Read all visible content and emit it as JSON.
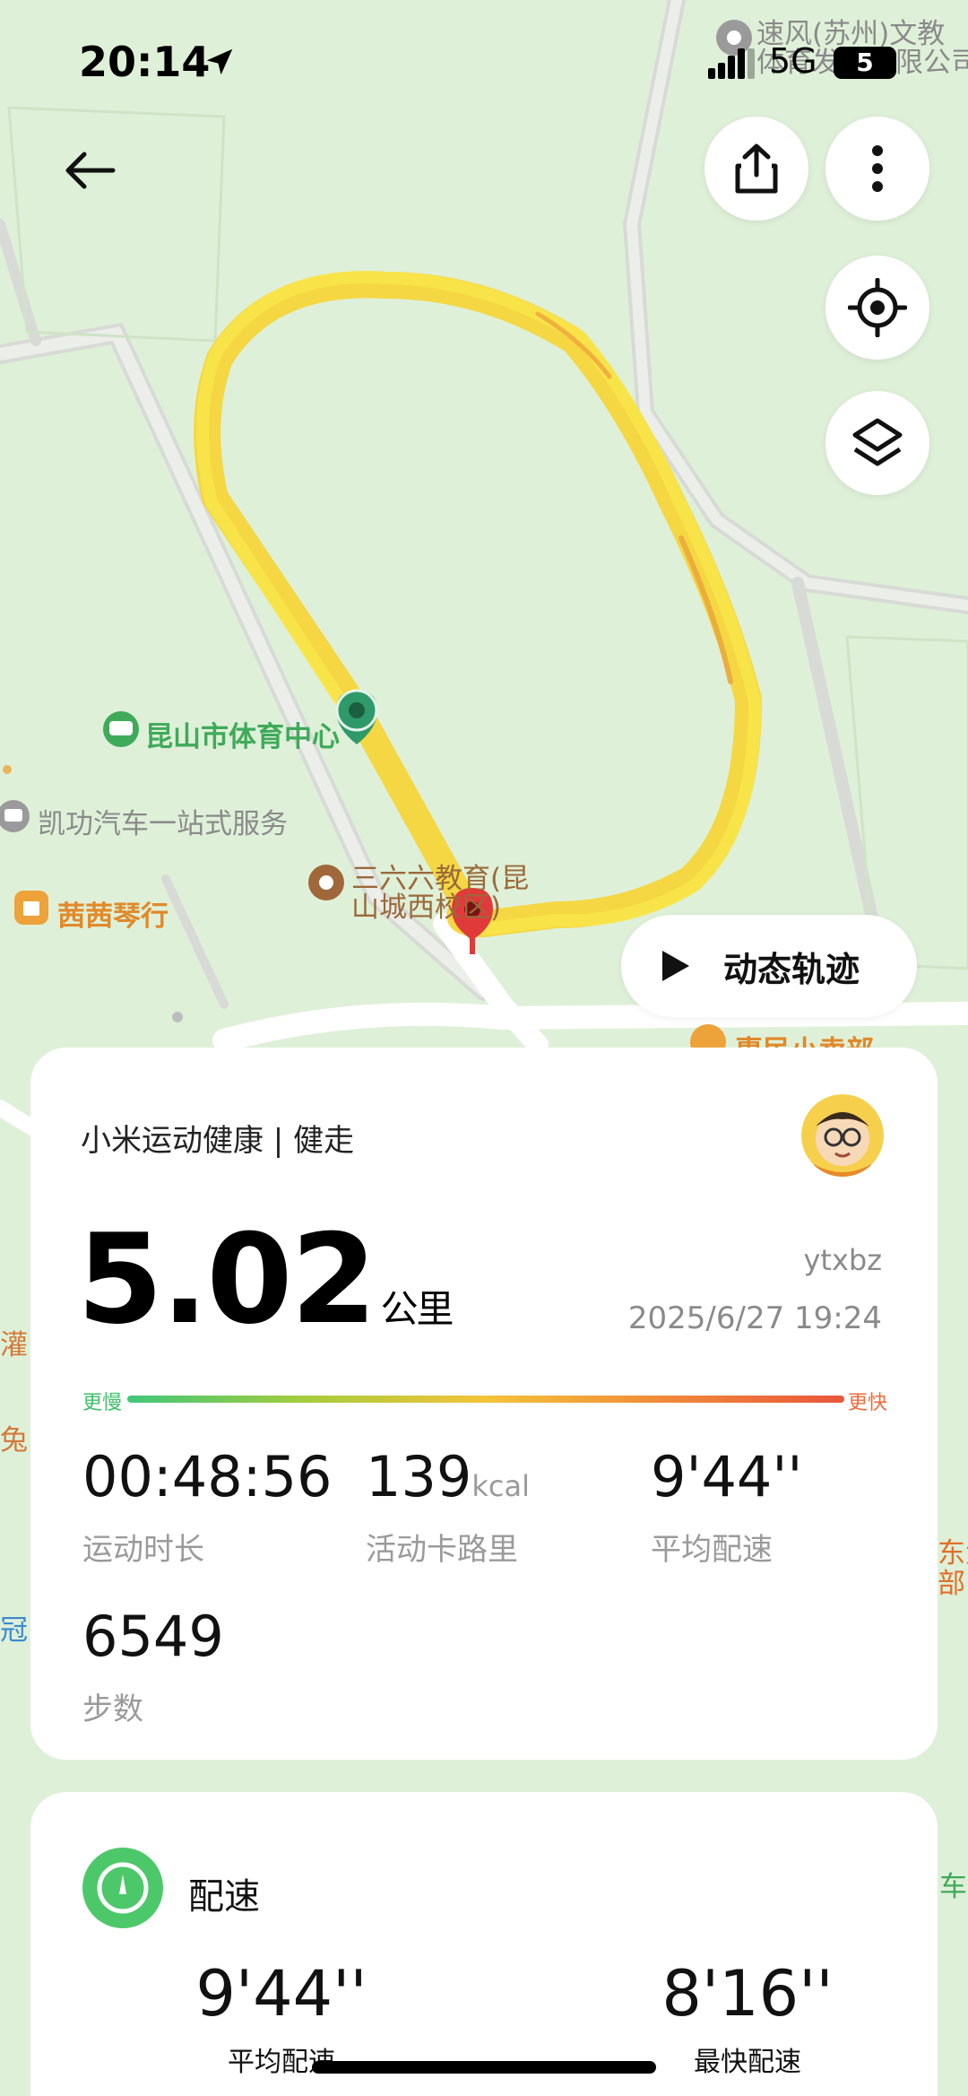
{
  "status_bar": {
    "time": "20:14",
    "network": "5G",
    "battery": "5"
  },
  "toolbar": {
    "back_icon": "arrow-left-icon",
    "share_icon": "share-icon",
    "more_icon": "more-vertical-icon",
    "locate_icon": "locate-target-icon",
    "layers_icon": "layers-icon"
  },
  "map": {
    "labels": [
      {
        "text": "速风(苏州)文教",
        "color": "#8a8a8a"
      },
      {
        "text": "体育发展有限公司",
        "color": "#8a8a8a"
      },
      {
        "text": "昆山市体育中心",
        "color": "#3faa5a"
      },
      {
        "text": "凯功汽车一站式服务",
        "color": "#8a8a8a"
      },
      {
        "text": "三六六教育(昆",
        "color": "#9a6a3a"
      },
      {
        "text": "山城西校区)",
        "color": "#9a6a3a"
      },
      {
        "text": "茜茜琴行",
        "color": "#e08a2a"
      },
      {
        "text": "惠民小卖部",
        "color": "#e08a2a"
      },
      {
        "text": "灌",
        "color": "#d27a3a"
      },
      {
        "text": "兔",
        "color": "#d27a3a"
      },
      {
        "text": "冠",
        "color": "#3a8ad2"
      },
      {
        "text": "东大",
        "color": "#e0702a"
      },
      {
        "text": "部",
        "color": "#e0702a"
      },
      {
        "text": "车",
        "color": "#3faa5a"
      }
    ]
  },
  "playback_button": {
    "label": "动态轨迹"
  },
  "summary": {
    "app_title": "小米运动健康 | 健走",
    "distance": "5.02",
    "distance_unit": "公里",
    "user_name": "ytxbz",
    "datetime": "2025/6/27 19:24",
    "scale_slow": "更慢",
    "scale_fast": "更快",
    "stats": [
      {
        "value": "00:48:56",
        "unit": "",
        "label": "运动时长"
      },
      {
        "value": "139",
        "unit": "kcal",
        "label": "活动卡路里"
      },
      {
        "value": "9'44''",
        "unit": "",
        "label": "平均配速"
      },
      {
        "value": "6549",
        "unit": "",
        "label": "步数"
      }
    ]
  },
  "pace": {
    "title": "配速",
    "avg_value": "9'44''",
    "avg_label": "平均配速",
    "fast_value": "8'16''",
    "fast_label": "最快配速"
  },
  "colors": {
    "map_bg": "#dff0d8",
    "track": "#f7e13a",
    "start_pin": "#2e9a6a",
    "end_pin": "#e03a3a",
    "accent_green": "#4cc86a"
  }
}
